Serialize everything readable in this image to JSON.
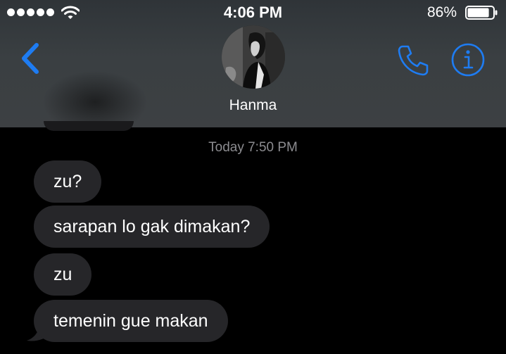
{
  "status_bar": {
    "time": "4:06 PM",
    "battery_percent": "86%",
    "battery_level": 0.86
  },
  "nav": {
    "contact_name": "Hanma",
    "back_icon": "chevron-left-icon",
    "call_icon": "phone-icon",
    "info_icon": "info-icon",
    "accent_color": "#1e7cf2"
  },
  "conversation": {
    "timestamp": "Today 7:50 PM",
    "messages": [
      {
        "text": "zu?"
      },
      {
        "text": "sarapan lo gak dimakan?"
      },
      {
        "text": "zu"
      },
      {
        "text": "temenin gue makan"
      }
    ]
  }
}
